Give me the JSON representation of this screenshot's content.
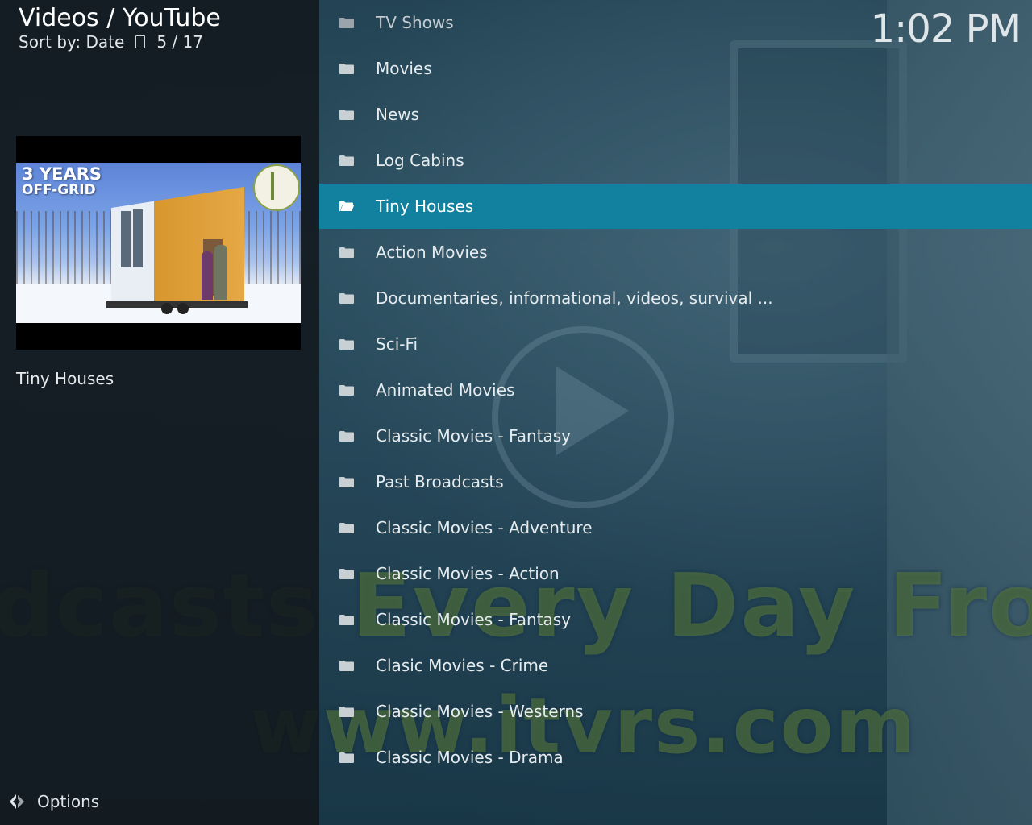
{
  "header": {
    "title": "Videos / YouTube",
    "sort_label": "Sort by: Date",
    "position": "5 / 17"
  },
  "clock": "1:02 PM",
  "preview": {
    "thumbnail_headline_line1": "3 YEARS",
    "thumbnail_headline_line2": "OFF-GRID",
    "title": "Tiny Houses"
  },
  "background_text": {
    "line1": "dcasts Every Day From",
    "line2": "www.itvrs.com"
  },
  "options_label": "Options",
  "list": {
    "focused_index": 4,
    "items": [
      {
        "label": "TV Shows",
        "icon": "folder-icon"
      },
      {
        "label": "Movies",
        "icon": "folder-icon"
      },
      {
        "label": "News",
        "icon": "folder-icon"
      },
      {
        "label": "Log Cabins",
        "icon": "folder-icon"
      },
      {
        "label": "Tiny Houses",
        "icon": "folder-open-icon"
      },
      {
        "label": "Action Movies",
        "icon": "folder-icon"
      },
      {
        "label": "Documentaries, informational, videos, survival ...",
        "icon": "folder-icon"
      },
      {
        "label": "Sci-Fi",
        "icon": "folder-icon"
      },
      {
        "label": "Animated Movies",
        "icon": "folder-icon"
      },
      {
        "label": "Classic Movies - Fantasy",
        "icon": "folder-icon"
      },
      {
        "label": "Past Broadcasts",
        "icon": "folder-icon"
      },
      {
        "label": "Classic Movies - Adventure",
        "icon": "folder-icon"
      },
      {
        "label": "Classic Movies - Action",
        "icon": "folder-icon"
      },
      {
        "label": "Classic Movies - Fantasy",
        "icon": "folder-icon"
      },
      {
        "label": "Clasic Movies - Crime",
        "icon": "folder-icon"
      },
      {
        "label": "Classic Movies - Westerns",
        "icon": "folder-icon"
      },
      {
        "label": "Classic Movies - Drama",
        "icon": "folder-icon"
      }
    ]
  },
  "colors": {
    "focus_highlight": "#12809f",
    "panel_bg": "#12181c",
    "text": "#e6ebee"
  }
}
